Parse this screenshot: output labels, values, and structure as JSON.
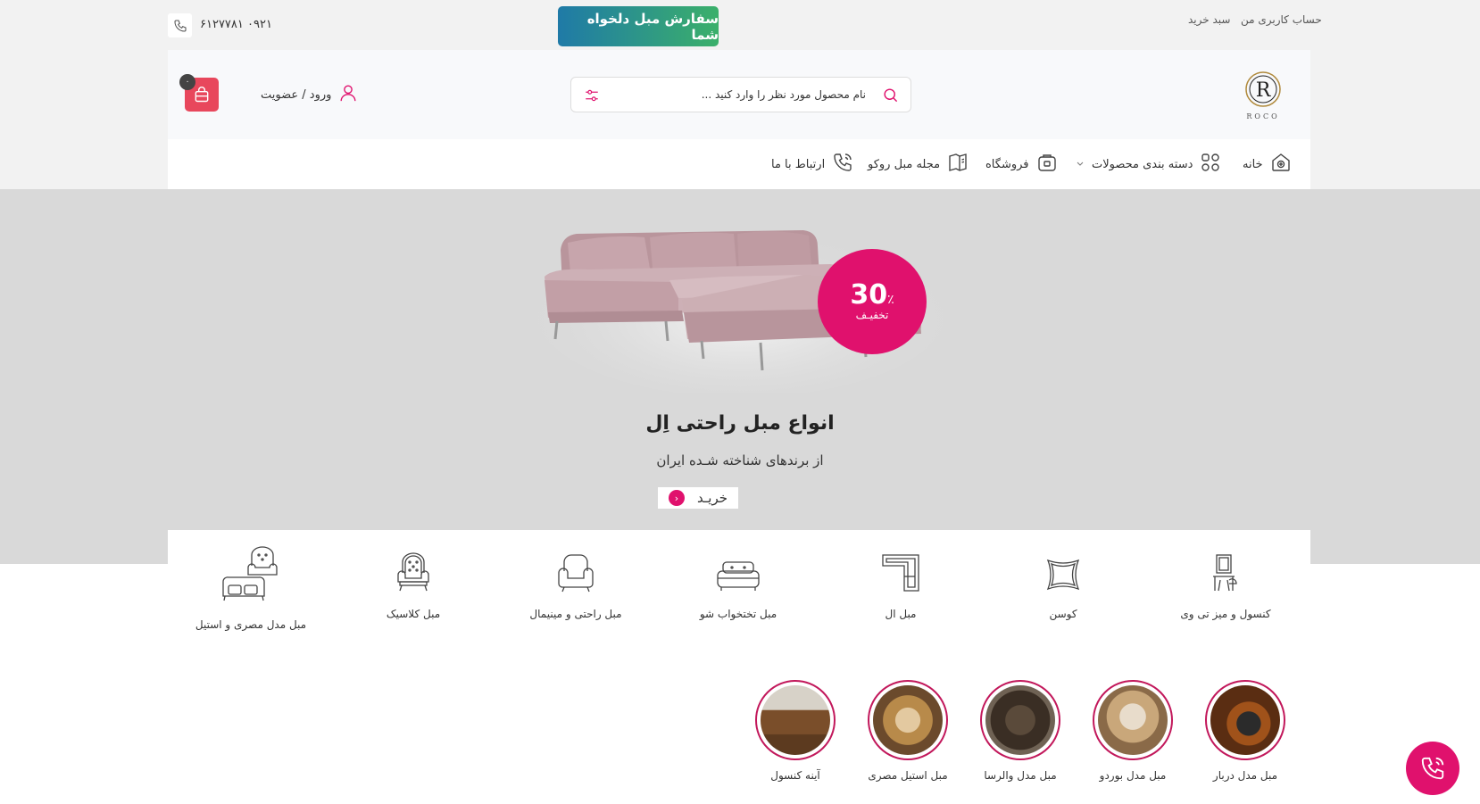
{
  "topbar": {
    "account_link": "حساب کاربری من",
    "cart_link": "سبد خرید",
    "custom_order_button": "سفارش مبل دلخواه شما",
    "phone": "۰۹۲۱ ۶۱۲۷۷۸۱"
  },
  "header": {
    "logo_text": "ROCO",
    "search_placeholder": "نام محصول مورد نظر را وارد کنید ...",
    "login_label": "ورود / عضویت",
    "cart_count": "۰"
  },
  "nav": {
    "items": [
      {
        "label": "خانه"
      },
      {
        "label": "دسته بندی محصولات"
      },
      {
        "label": "فروشگاه"
      },
      {
        "label": "مجله مبل روکو"
      },
      {
        "label": "ارتباط با ما"
      }
    ]
  },
  "hero": {
    "discount_number": "30",
    "discount_symbol": "٪",
    "discount_label": "تخفیـف",
    "title": "انواع مبل راحتی اِل",
    "subtitle": "از برندهای شناخته شـده ایران",
    "buy_label": "خریـد"
  },
  "categories": [
    {
      "label": "کنسول و میز تی وی"
    },
    {
      "label": "کوسن"
    },
    {
      "label": "مبل ال"
    },
    {
      "label": "مبل تختخواب شو"
    },
    {
      "label": "مبل راحتی و مینیمال"
    },
    {
      "label": "مبل کلاسیک"
    },
    {
      "label": "مبل مدل مصری و استیل"
    }
  ],
  "featured": [
    {
      "label": "مبل مدل دربار"
    },
    {
      "label": "مبل مدل بوردو"
    },
    {
      "label": "مبل مدل والرسا"
    },
    {
      "label": "مبل استیل مصری"
    },
    {
      "label": "آینه کنسول"
    }
  ],
  "colors": {
    "accent": "#e0116d",
    "cart": "#e8475c",
    "gradient_start": "#1f7aa7",
    "gradient_end": "#3bb06a"
  }
}
